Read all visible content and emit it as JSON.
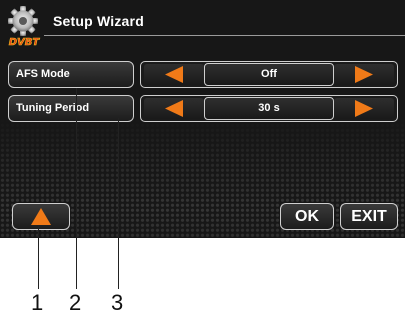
{
  "title": "Setup Wizard",
  "logo_text": "DVBT",
  "rows": [
    {
      "label": "AFS Mode",
      "value": "Off"
    },
    {
      "label": "Tuning Period",
      "value": "30 s"
    }
  ],
  "buttons": {
    "ok": "OK",
    "exit": "EXIT"
  },
  "callouts": [
    "1",
    "2",
    "3"
  ],
  "colors": {
    "accent_orange": "#f07a18",
    "background": "#171717",
    "border": "#cfcfcf"
  },
  "icons": {
    "left_arrow": "triangle-left",
    "right_arrow": "triangle-right",
    "up_arrow": "triangle-up"
  }
}
